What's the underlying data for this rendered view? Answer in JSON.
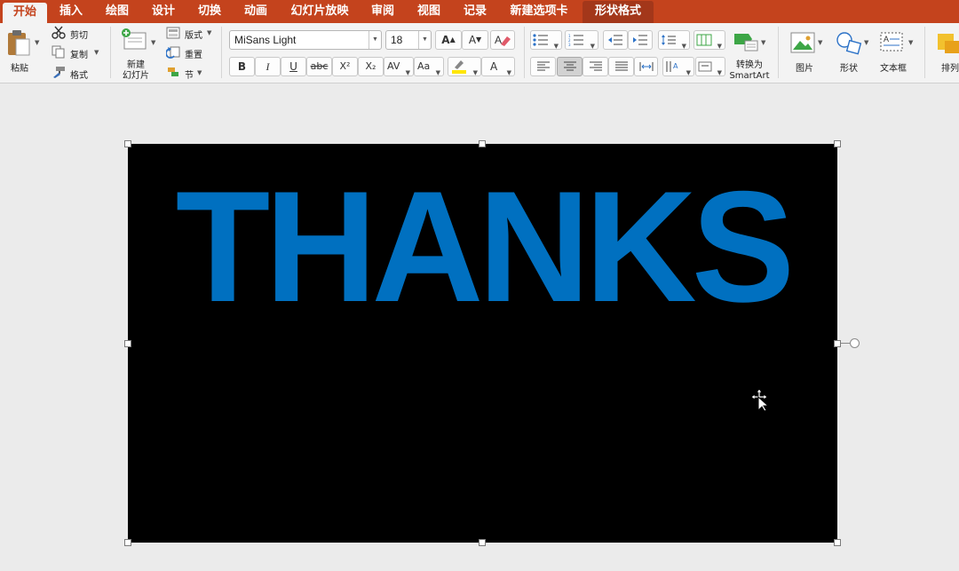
{
  "tabs": [
    {
      "label": "开始",
      "active": true
    },
    {
      "label": "插入"
    },
    {
      "label": "绘图"
    },
    {
      "label": "设计"
    },
    {
      "label": "切换"
    },
    {
      "label": "动画"
    },
    {
      "label": "幻灯片放映"
    },
    {
      "label": "审阅"
    },
    {
      "label": "视图"
    },
    {
      "label": "记录"
    },
    {
      "label": "新建选项卡"
    },
    {
      "label": "形状格式",
      "contextual": true
    }
  ],
  "clipboard": {
    "paste_label": "粘贴",
    "cut_label": "剪切",
    "copy_label": "复制",
    "format_label": "格式"
  },
  "slides": {
    "new_slide_label": "新建\n幻灯片",
    "layout_label": "版式",
    "reset_label": "重置",
    "section_label": "节"
  },
  "font": {
    "name": "MiSans Light",
    "size": "18",
    "grow_label": "A",
    "shrink_label": "A",
    "bold_label": "B",
    "italic_label": "I",
    "underline_label": "U",
    "strike_label": "abc",
    "superscript_label": "X²",
    "subscript_label": "X₂",
    "spacing_label": "AV",
    "case_label": "Aa",
    "font_color_label": "A"
  },
  "paragraph": {
    "smartart_label": "转换为\nSmartArt"
  },
  "insert": {
    "picture_label": "图片",
    "shape_label": "形状",
    "textbox_label": "文本框",
    "arrange_label": "排列"
  },
  "slide": {
    "text": "THANKS",
    "text_color": "#0070c0",
    "background": "#000000"
  },
  "colors": {
    "tab_bar": "#c4431d",
    "ribbon": "#f3f3f3",
    "canvas": "#ebebeb"
  }
}
